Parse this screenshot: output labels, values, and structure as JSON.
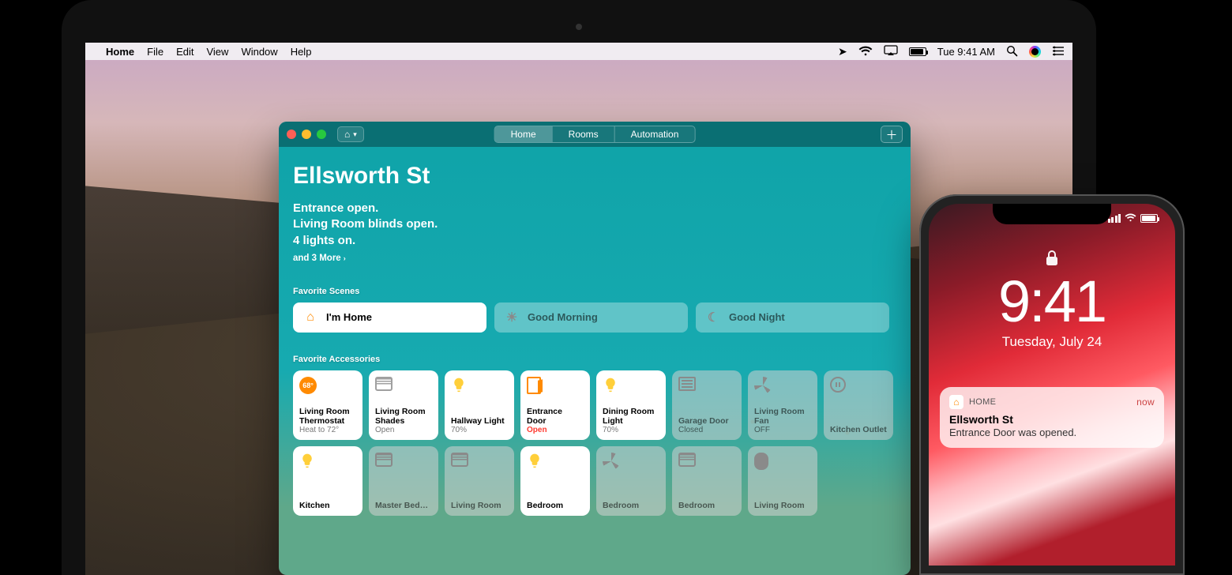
{
  "mac_menubar": {
    "app_name": "Home",
    "menus": [
      "File",
      "Edit",
      "View",
      "Window",
      "Help"
    ],
    "clock": "Tue 9:41 AM"
  },
  "home_app": {
    "tabs": {
      "home": "Home",
      "rooms": "Rooms",
      "automation": "Automation"
    },
    "house_name": "Ellsworth St",
    "status": [
      "Entrance open.",
      "Living Room blinds open.",
      "4 lights on."
    ],
    "more": "and 3 More",
    "section_scenes": "Favorite Scenes",
    "scenes": [
      {
        "label": "I'm Home",
        "active": true,
        "icon": "home"
      },
      {
        "label": "Good Morning",
        "active": false,
        "icon": "sun"
      },
      {
        "label": "Good Night",
        "active": false,
        "icon": "moon"
      }
    ],
    "section_accessories": "Favorite Accessories",
    "tiles_row1": [
      {
        "name": "Living Room Thermostat",
        "state": "Heat to 72°",
        "on": true,
        "icon": "thermo",
        "badge": "68°"
      },
      {
        "name": "Living Room Shades",
        "state": "Open",
        "on": true,
        "icon": "shades"
      },
      {
        "name": "Hallway Light",
        "state": "70%",
        "on": true,
        "icon": "bulb"
      },
      {
        "name": "Entrance Door",
        "state": "Open",
        "on": true,
        "icon": "door",
        "state_red": true
      },
      {
        "name": "Dining Room Light",
        "state": "70%",
        "on": true,
        "icon": "bulb"
      },
      {
        "name": "Garage Door",
        "state": "Closed",
        "on": false,
        "icon": "garage"
      },
      {
        "name": "Living Room Fan",
        "state": "OFF",
        "on": false,
        "icon": "fan"
      },
      {
        "name": "Kitchen Outlet",
        "state": "",
        "on": false,
        "icon": "outlet"
      }
    ],
    "tiles_row2": [
      {
        "name": "Kitchen",
        "state": "",
        "on": true,
        "icon": "bulb"
      },
      {
        "name": "Master Bed…",
        "state": "",
        "on": false,
        "icon": "shades"
      },
      {
        "name": "Living Room",
        "state": "",
        "on": false,
        "icon": "shades"
      },
      {
        "name": "Bedroom",
        "state": "",
        "on": true,
        "icon": "bulb"
      },
      {
        "name": "Bedroom",
        "state": "",
        "on": false,
        "icon": "fan"
      },
      {
        "name": "Bedroom",
        "state": "",
        "on": false,
        "icon": "shades"
      },
      {
        "name": "Living Room",
        "state": "",
        "on": false,
        "icon": "homepod"
      }
    ]
  },
  "iphone": {
    "time": "9:41",
    "date": "Tuesday, July 24",
    "notification": {
      "app": "HOME",
      "when": "now",
      "title": "Ellsworth St",
      "body": "Entrance Door was opened."
    }
  }
}
